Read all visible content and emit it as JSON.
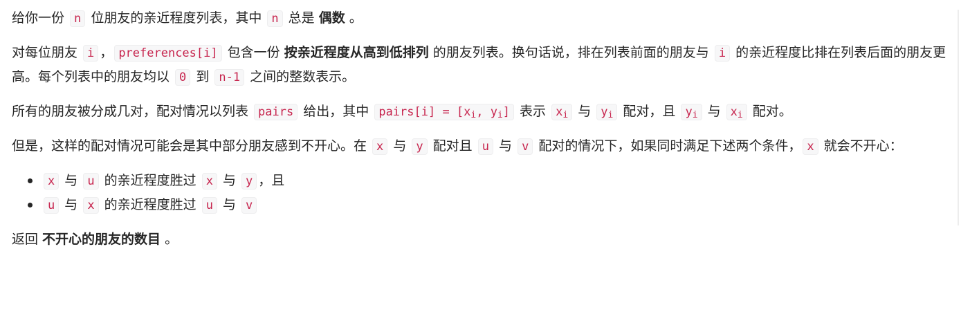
{
  "p1": {
    "t1": "给你一份 ",
    "c1": "n",
    "t2": " 位朋友的亲近程度列表，其中 ",
    "c2": "n",
    "t3": " 总是 ",
    "b1": "偶数",
    "t4": " 。"
  },
  "p2": {
    "t1": "对每位朋友 ",
    "c1": "i",
    "t2": "，",
    "c2": "preferences[i]",
    "t3": " 包含一份 ",
    "b1": "按亲近程度从高到低排列",
    "t4": " 的朋友列表。换句话说，排在列表前面的朋友与 ",
    "c3": "i",
    "t5": " 的亲近程度比排在列表后面的朋友更高。每个列表中的朋友均以 ",
    "c4": "0",
    "t6": " 到 ",
    "c5": "n-1",
    "t7": " 之间的整数表示。"
  },
  "p3": {
    "t1": "所有的朋友被分成几对，配对情况以列表 ",
    "c1": "pairs",
    "t2": " 给出，其中 ",
    "c2a": "pairs[i] = [x",
    "c2sub1": "i",
    "c2b": ", y",
    "c2sub2": "i",
    "c2c": "]",
    "t3": " 表示 ",
    "c3": "x",
    "c3sub": "i",
    "t4": " 与 ",
    "c4": "y",
    "c4sub": "i",
    "t5": " 配对，且 ",
    "c5": "y",
    "c5sub": "i",
    "t6": " 与 ",
    "c6": "x",
    "c6sub": "i",
    "t7": " 配对。"
  },
  "p4": {
    "t1": "但是，这样的配对情况可能会是其中部分朋友感到不开心。在 ",
    "c1": "x",
    "t2": " 与 ",
    "c2": "y",
    "t3": " 配对且 ",
    "c3": "u",
    "t4": " 与 ",
    "c4": "v",
    "t5": " 配对的情况下，如果同时满足下述两个条件，",
    "c5": "x",
    "t6": " 就会不开心："
  },
  "list": {
    "item1": {
      "c1": "x",
      "t1": " 与 ",
      "c2": "u",
      "t2": " 的亲近程度胜过 ",
      "c3": "x",
      "t3": " 与 ",
      "c4": "y",
      "t4": "，且"
    },
    "item2": {
      "c1": "u",
      "t1": " 与 ",
      "c2": "x",
      "t2": " 的亲近程度胜过 ",
      "c3": "u",
      "t3": " 与 ",
      "c4": "v"
    }
  },
  "p5": {
    "t1": "返回 ",
    "b1": "不开心的朋友的数目",
    "t2": " 。"
  }
}
